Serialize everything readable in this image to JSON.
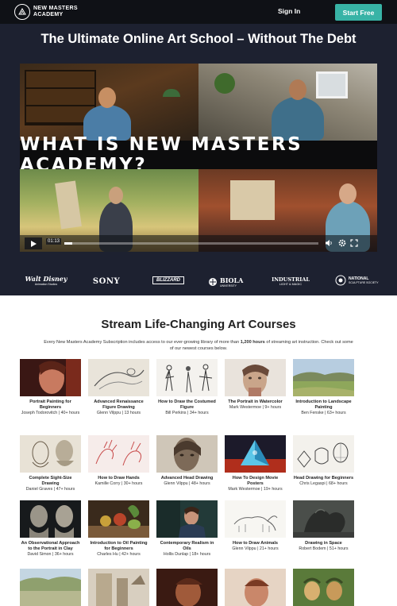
{
  "nav": {
    "logo_text": "NEW MASTERS ACADEMY",
    "sign_in": "Sign In",
    "start_free": "Start Free"
  },
  "hero": {
    "title": "The Ultimate Online Art School – Without The Debt",
    "video": {
      "banner": "WHAT IS NEW MASTERS ACADEMY?",
      "time": "01:13",
      "progress": 0.03,
      "icons": [
        "play-icon",
        "volume-icon",
        "settings-icon",
        "fullscreen-icon"
      ]
    }
  },
  "partners": [
    {
      "name": "Walt Disney",
      "sub": "Animation Studios"
    },
    {
      "name": "SONY",
      "sub": ""
    },
    {
      "name": "BLIZZARD",
      "sub": ""
    },
    {
      "name": "BIOLA",
      "sub": "UNIVERSITY"
    },
    {
      "name": "INDUSTRIAL",
      "sub": "LIGHT & MAGIC"
    },
    {
      "name": "NATIONAL",
      "sub": "SCULPTURE SOCIETY"
    }
  ],
  "courses_section": {
    "title": "Stream Life-Changing Art Courses",
    "intro_before": "Every New Masters Academy Subscription includes access to our ever-growing library of more than ",
    "intro_bold": "1,200 hours",
    "intro_after": " of streaming art instruction. Check out some of our newest courses below."
  },
  "courses": [
    {
      "title": "Portrait Painting for Beginners",
      "meta": "Joseph Todorovitch | 40+ hours"
    },
    {
      "title": "Advanced Renaissance Figure Drawing",
      "meta": "Glenn Vilppu | 13 hours"
    },
    {
      "title": "How to Draw the Costumed Figure",
      "meta": "Bill Perkins | 34+ hours"
    },
    {
      "title": "The Portrait in Watercolor",
      "meta": "Mark Westermoe | 9+ hours"
    },
    {
      "title": "Introduction to Landscape Painting",
      "meta": "Ben Fenske | 63+ hours"
    },
    {
      "title": "Complete Sight-Size Drawing",
      "meta": "Daniel Graves | 47+ hours"
    },
    {
      "title": "How to Draw Hands",
      "meta": "Kamille Corry | 30+ hours"
    },
    {
      "title": "Advanced Head Drawing",
      "meta": "Glenn Vilppu | 48+ hours"
    },
    {
      "title": "How To Design Movie Posters",
      "meta": "Mark Westermoe | 19+ hours"
    },
    {
      "title": "Head Drawing for Beginners",
      "meta": "Chris Legaspi | 68+ hours"
    },
    {
      "title": "An Observational Approach to the Portrait in Clay",
      "meta": "David Simon | 36+ hours"
    },
    {
      "title": "Introduction to Oil Painting for Beginners",
      "meta": "Charles Hu | 42+ hours"
    },
    {
      "title": "Contemporary Realism in Oils",
      "meta": "Hollis Dunlap | 18+ hours"
    },
    {
      "title": "How to Draw Animals",
      "meta": "Glenn Vilppu | 21+ hours"
    },
    {
      "title": "Drawing in Space",
      "meta": "Robert Bodem | 51+ hours"
    }
  ]
}
